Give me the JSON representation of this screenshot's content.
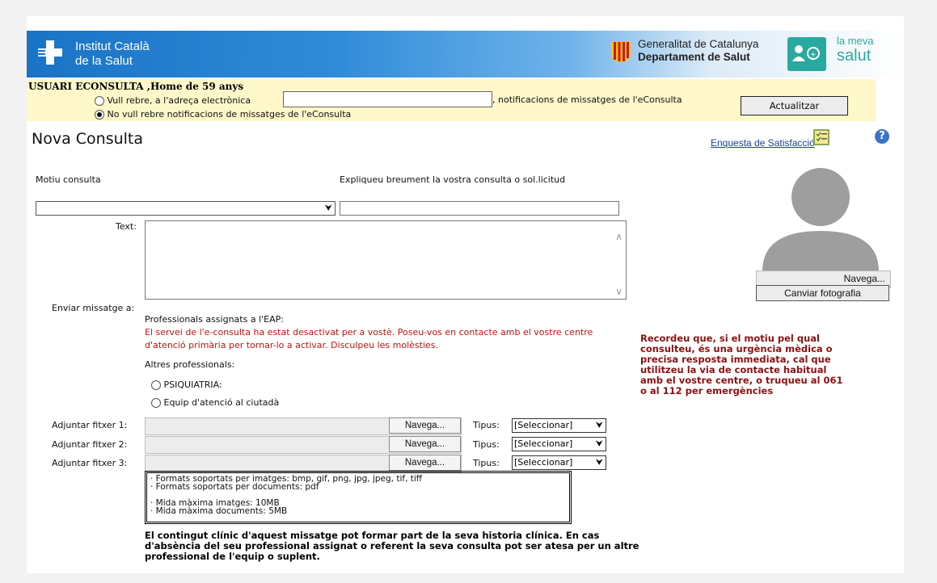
{
  "header": {
    "org_line1": "Institut Català",
    "org_line2": "de la Salut",
    "gov_line1": "Generalitat de Catalunya",
    "gov_line2": "Departament de Salut",
    "brand_line1": "la meva",
    "brand_line2": "salut"
  },
  "user": {
    "title": "USUARI ECONSULTA ,Home de 59 anys",
    "opt_receive": "Vull rebre, a l'adreça electrònica",
    "opt_receive_suffix": ", notificacions de missatges de l'eConsulta",
    "opt_no_receive": "No vull rebre notificacions de missatges de l'eConsulta",
    "email_value": "",
    "selected_option": "no_receive",
    "update_button": "Actualitzar"
  },
  "page": {
    "title": "Nova Consulta",
    "survey_link": "Enquesta de Satisfacció"
  },
  "form": {
    "reason_label": "Motiu consulta",
    "reason_value": "",
    "explain_label": "Expliqueu breument la vostra consulta o sol.licitud",
    "explain_value": "",
    "text_label": "Text:",
    "send_to_label": "Enviar missatge a:",
    "eap_label": "Professionals assignats a l'EAP:",
    "eap_disabled_msg": "El servei de l'e-consulta ha estat desactivat per a vostè. Poseu-vos en contacte amb el vostre centre d'atenció primària per tornar-lo a activar. Disculpeu les molèsties.",
    "other_label": "Altres professionals:",
    "other_options": [
      "PSIQUIATRIA:",
      "Equip d'atenció al ciutadà"
    ],
    "attachments": [
      {
        "label": "Adjuntar fitxer 1:",
        "browse": "Navega...",
        "type_label": "Tipus:",
        "type_value": "[Seleccionar]"
      },
      {
        "label": "Adjuntar fitxer 2:",
        "browse": "Navega...",
        "type_label": "Tipus:",
        "type_value": "[Seleccionar]"
      },
      {
        "label": "Adjuntar fitxer 3:",
        "browse": "Navega...",
        "type_label": "Tipus:",
        "type_value": "[Seleccionar]"
      }
    ],
    "formats": {
      "images": "· Formats soportats per imatges: bmp, gif, png, jpg, jpeg, tif, tiff",
      "documents": "· Formats soportats per documents: pdf",
      "max_images": "· Mida màxima imatges: 10MB",
      "max_docs": "· Mida màxima documents: 5MB"
    },
    "legal_notice": "El contingut clínic d'aquest missatge pot formar part de la seva historia clínica. En cas d'absència del seu professional assignat o referent la seva consulta pot ser atesa per un altre professional de l'equip o suplent."
  },
  "photo": {
    "browse_button": "Navega...",
    "change_button": "Canviar fotografia"
  },
  "warning": "Recordeu que, si el motiu pel qual consulteu, és una urgència mèdica o precisa resposta immediata, cal que utilitzeu la via de contacte habitual amb el vostre centre, o truqueu al 061 o al 112 per emergències",
  "colors": {
    "header_blue": "#1a73c4",
    "user_band": "#fdf7c9",
    "disabled_red": "#c21111",
    "warning_red": "#8c1010",
    "brand_teal": "#2aa9a0",
    "link_blue": "#1a3ea3"
  }
}
